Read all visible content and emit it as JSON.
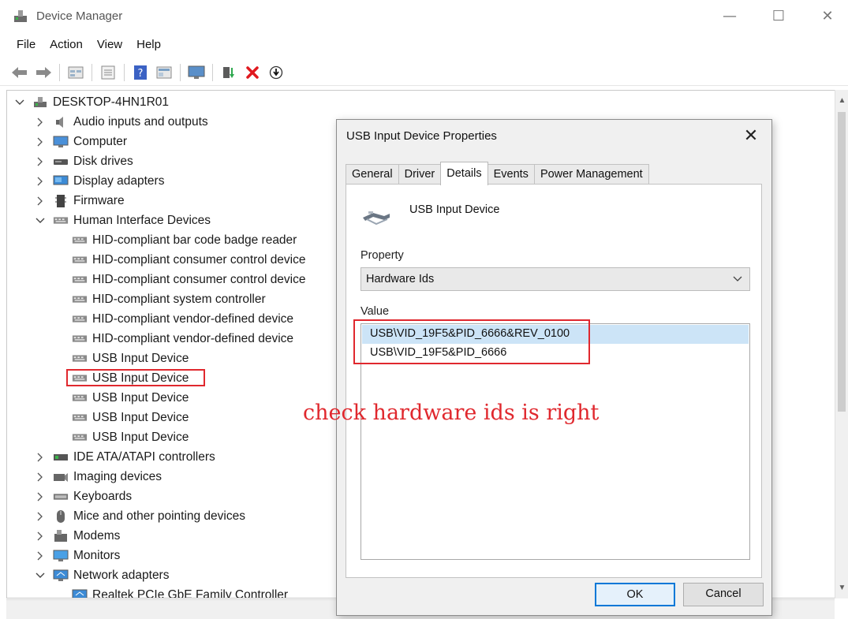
{
  "window": {
    "title": "Device Manager",
    "minimize_glyph": "—",
    "maximize_glyph": "☐",
    "close_glyph": "✕"
  },
  "menu": [
    "File",
    "Action",
    "View",
    "Help"
  ],
  "toolbar_icons": [
    "back-arrow-icon",
    "forward-arrow-icon",
    "properties-icon",
    "view-icon",
    "help-icon",
    "view-details-icon",
    "monitor-icon",
    "update-driver-icon",
    "uninstall-icon",
    "download-icon"
  ],
  "colors": {
    "annotation_red": "#e0282e",
    "selection_blue": "#cce4f7",
    "ok_border": "#0078d7"
  },
  "tree": {
    "root": "DESKTOP-4HN1R01",
    "items": [
      {
        "label": "Audio inputs and outputs",
        "expanded": false,
        "level": 1,
        "icon": "speaker-icon"
      },
      {
        "label": "Computer",
        "expanded": false,
        "level": 1,
        "icon": "computer-icon"
      },
      {
        "label": "Disk drives",
        "expanded": false,
        "level": 1,
        "icon": "disk-icon"
      },
      {
        "label": "Display adapters",
        "expanded": false,
        "level": 1,
        "icon": "display-adapter-icon"
      },
      {
        "label": "Firmware",
        "expanded": false,
        "level": 1,
        "icon": "firmware-icon"
      },
      {
        "label": "Human Interface Devices",
        "expanded": true,
        "level": 1,
        "icon": "hid-icon"
      },
      {
        "label": "HID-compliant bar code badge reader",
        "level": 2,
        "icon": "hid-icon"
      },
      {
        "label": "HID-compliant consumer control device",
        "level": 2,
        "icon": "hid-icon"
      },
      {
        "label": "HID-compliant consumer control device",
        "level": 2,
        "icon": "hid-icon"
      },
      {
        "label": "HID-compliant system controller",
        "level": 2,
        "icon": "hid-icon"
      },
      {
        "label": "HID-compliant vendor-defined device",
        "level": 2,
        "icon": "hid-icon"
      },
      {
        "label": "HID-compliant vendor-defined device",
        "level": 2,
        "icon": "hid-icon"
      },
      {
        "label": "USB Input Device",
        "level": 2,
        "icon": "hid-icon"
      },
      {
        "label": "USB Input Device",
        "level": 2,
        "icon": "hid-icon",
        "selected": true
      },
      {
        "label": "USB Input Device",
        "level": 2,
        "icon": "hid-icon"
      },
      {
        "label": "USB Input Device",
        "level": 2,
        "icon": "hid-icon"
      },
      {
        "label": "USB Input Device",
        "level": 2,
        "icon": "hid-icon"
      },
      {
        "label": "IDE ATA/ATAPI controllers",
        "expanded": false,
        "level": 1,
        "icon": "ide-icon"
      },
      {
        "label": "Imaging devices",
        "expanded": false,
        "level": 1,
        "icon": "camera-icon"
      },
      {
        "label": "Keyboards",
        "expanded": false,
        "level": 1,
        "icon": "keyboard-icon"
      },
      {
        "label": "Mice and other pointing devices",
        "expanded": false,
        "level": 1,
        "icon": "mouse-icon"
      },
      {
        "label": "Modems",
        "expanded": false,
        "level": 1,
        "icon": "modem-icon"
      },
      {
        "label": "Monitors",
        "expanded": false,
        "level": 1,
        "icon": "monitor-icon"
      },
      {
        "label": "Network adapters",
        "expanded": true,
        "level": 1,
        "icon": "network-icon"
      },
      {
        "label": "Realtek PCIe GbE Family Controller",
        "level": 2,
        "icon": "network-icon"
      }
    ]
  },
  "dialog": {
    "title": "USB Input Device Properties",
    "close_glyph": "✕",
    "tabs": [
      "General",
      "Driver",
      "Details",
      "Events",
      "Power Management"
    ],
    "active_tab": "Details",
    "device_name": "USB Input Device",
    "property_label": "Property",
    "property_value": "Hardware Ids",
    "value_label": "Value",
    "values": [
      "USB\\VID_19F5&PID_6666&REV_0100",
      "USB\\VID_19F5&PID_6666"
    ],
    "ok": "OK",
    "cancel": "Cancel"
  },
  "annotation": "check hardware ids is right"
}
